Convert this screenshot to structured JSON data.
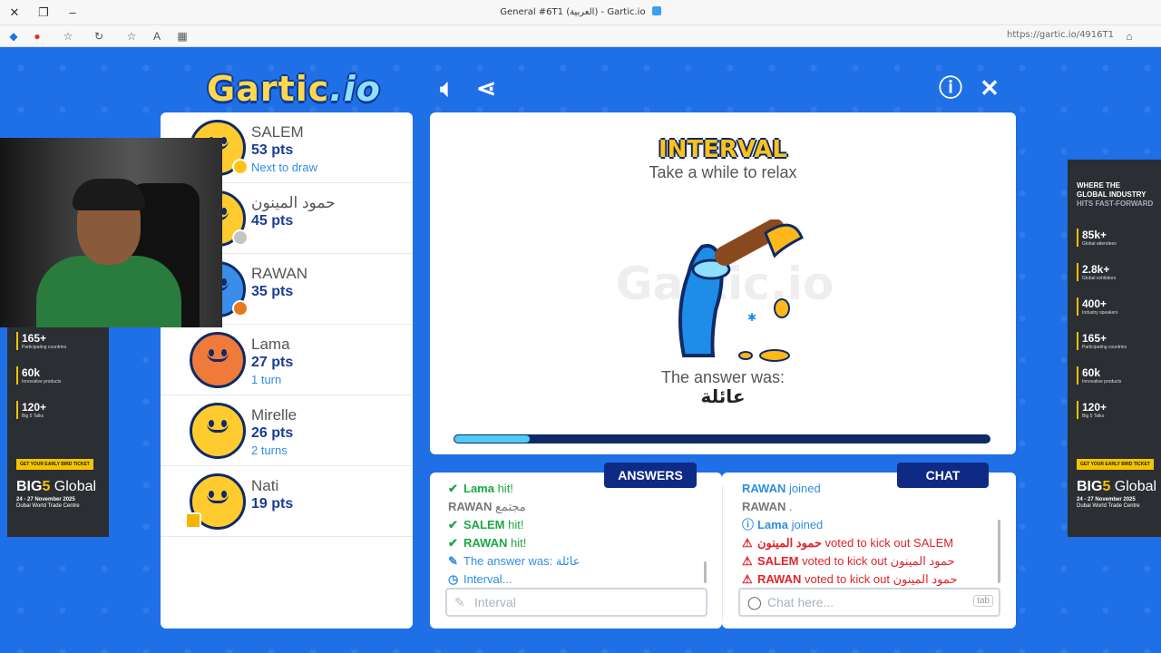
{
  "browser": {
    "window_title": "General #6T1 (العربية) - Gartic.io",
    "url": "https://gartic.io/4916T1"
  },
  "header": {
    "logo_main": "Gartic",
    "logo_io": ".io"
  },
  "players": [
    {
      "name": "SALEM",
      "points": "53 pts",
      "sub": "Next to draw",
      "badge_color": "#ffc21a"
    },
    {
      "name": "حمود المينون",
      "points": "45 pts",
      "sub": "",
      "badge_color": "#c5c5c5"
    },
    {
      "name": "RAWAN",
      "points": "35 pts",
      "sub": "",
      "badge_color": "#e87a1c"
    },
    {
      "name": "Lama",
      "points": "27 pts",
      "sub": "1 turn",
      "badge_color": ""
    },
    {
      "name": "Mirelle",
      "points": "26 pts",
      "sub": "2 turns",
      "badge_color": ""
    },
    {
      "name": "Nati",
      "points": "19 pts",
      "sub": "",
      "badge_color": ""
    }
  ],
  "canvas": {
    "title": "INTERVAL",
    "subtitle": "Take a while to relax",
    "watermark": "Gartic.io",
    "answer_label": "The answer was:",
    "answer_word": "عائلة",
    "progress": 0.14
  },
  "answers": {
    "tab_label": "ANSWERS",
    "messages": [
      {
        "icon": "✔",
        "color": "c-green",
        "name": "Lama",
        "text": " hit!"
      },
      {
        "icon": "",
        "color": "c-gray",
        "name": "RAWAN",
        "text": " مجتمع"
      },
      {
        "icon": "✔",
        "color": "c-green",
        "name": "SALEM",
        "text": " hit!"
      },
      {
        "icon": "✔",
        "color": "c-green",
        "name": "RAWAN",
        "text": " hit!"
      },
      {
        "icon": "✎",
        "color": "c-blue",
        "name": "",
        "text": "The answer was: عائلة"
      },
      {
        "icon": "◷",
        "color": "c-blue",
        "name": "",
        "text": "Interval..."
      }
    ],
    "input_placeholder": "Interval"
  },
  "chat": {
    "tab_label": "CHAT",
    "messages": [
      {
        "icon": "",
        "color": "c-blue",
        "name": "RAWAN",
        "text": " joined"
      },
      {
        "icon": "",
        "color": "c-gray",
        "name": "RAWAN",
        "text": " ."
      },
      {
        "icon": "ⓘ",
        "color": "c-blue",
        "name": "Lama",
        "text": " joined"
      },
      {
        "icon": "⚠",
        "color": "c-red",
        "name": "حمود المينون",
        "text": " voted to kick out SALEM"
      },
      {
        "icon": "⚠",
        "color": "c-red",
        "name": "SALEM",
        "text": " voted to kick out حمود المينون"
      },
      {
        "icon": "⚠",
        "color": "c-red",
        "name": "RAWAN",
        "text": " voted to kick out حمود المينون"
      }
    ],
    "input_placeholder": "Chat here...",
    "tab_hint": "tab"
  },
  "ad_left": {
    "stats": [
      {
        "num": "165+",
        "label": "Participating countries"
      },
      {
        "num": "60k",
        "label": "Innovative products"
      },
      {
        "num": "120+",
        "label": "Big 5 Talks"
      }
    ],
    "cta": "GET YOUR EARLY BIRD TICKET",
    "brand_big": "BIG",
    "brand_num": "5",
    "brand_global": " Global",
    "dates": "24 - 27 November 2025",
    "venue": "Dubai World Trade Centre"
  },
  "ad_right": {
    "headline1": "WHERE THE",
    "headline2": "GLOBAL INDUSTRY",
    "headline3": "HITS FAST-FORWARD",
    "stats": [
      {
        "num": "85k+",
        "label": "Global attendees"
      },
      {
        "num": "2.8k+",
        "label": "Global exhibitors"
      },
      {
        "num": "400+",
        "label": "Industry speakers"
      },
      {
        "num": "165+",
        "label": "Participating countries"
      },
      {
        "num": "60k",
        "label": "Innovative products"
      },
      {
        "num": "120+",
        "label": "Big 5 Talks"
      }
    ],
    "cta": "GET YOUR EARLY BIRD TICKET",
    "brand_big": "BIG",
    "brand_num": "5",
    "brand_global": " Global",
    "dates": "24 - 27 November 2025",
    "venue": "Dubai World Trade Centre"
  }
}
